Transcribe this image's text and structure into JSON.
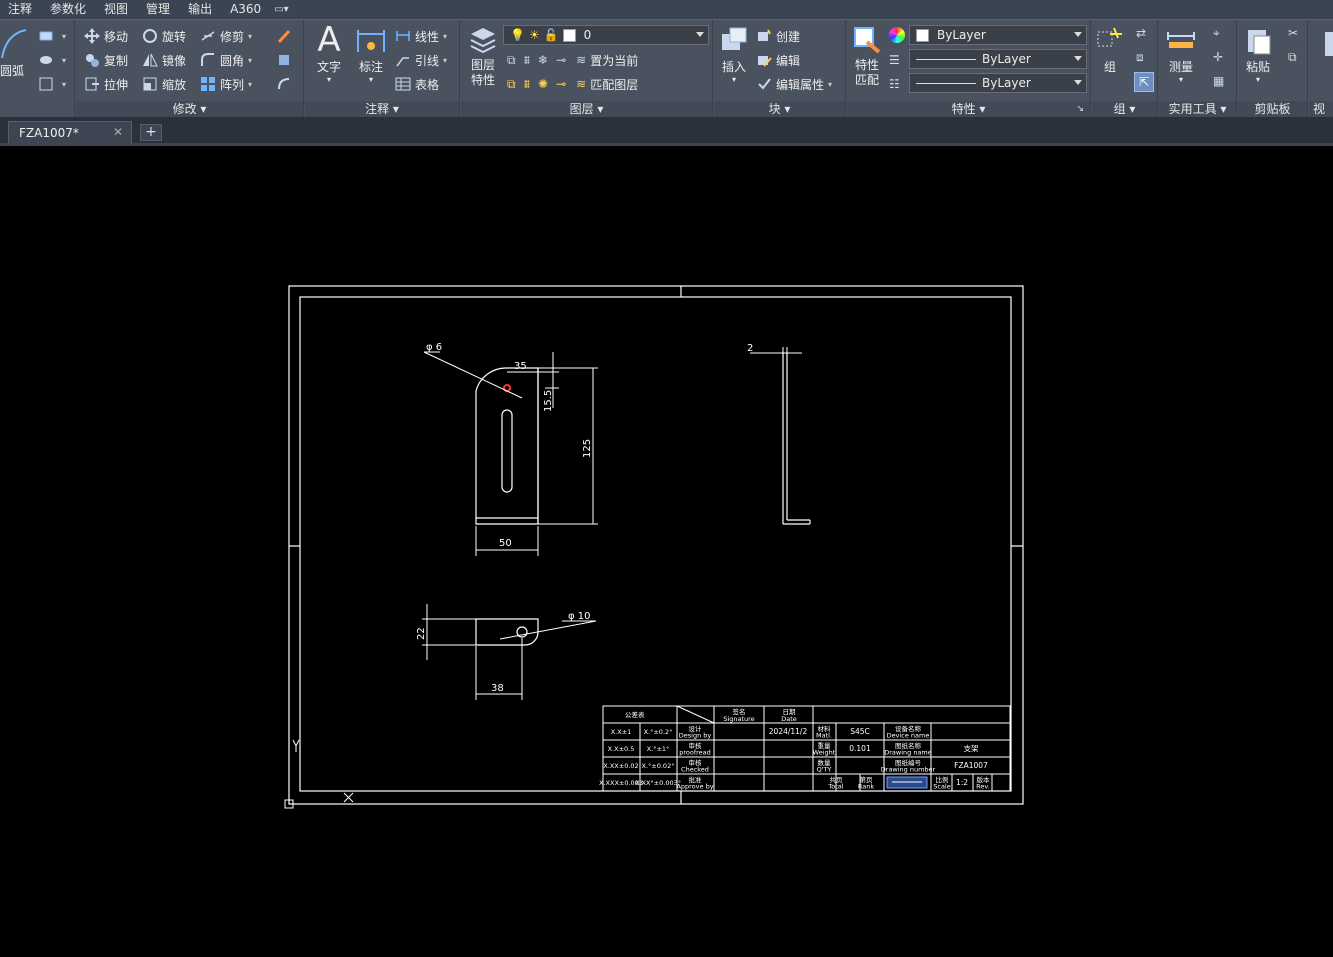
{
  "menu": {
    "items": [
      "注释",
      "参数化",
      "视图",
      "管理",
      "输出",
      "A360"
    ]
  },
  "ribbon": {
    "arc_label": "圆弧",
    "modify": {
      "title": "修改",
      "move": "移动",
      "rotate": "旋转",
      "trim": "修剪",
      "copy": "复制",
      "mirror": "镜像",
      "fillet": "圆角",
      "stretch": "拉伸",
      "scale": "缩放",
      "array": "阵列"
    },
    "annotation": {
      "title": "注释",
      "text": "文字",
      "dimension": "标注",
      "linear": "线性",
      "leader": "引线",
      "table": "表格"
    },
    "layers": {
      "title": "图层",
      "layer_props": "图层\n特性",
      "layer_name": "0",
      "set_current": "置为当前",
      "match_layer": "匹配图层"
    },
    "block": {
      "title": "块",
      "insert": "插入",
      "create": "创建",
      "edit": "编辑",
      "edit_attr": "编辑属性"
    },
    "properties": {
      "title": "特性",
      "match": "特性\n匹配",
      "color": "ByLayer",
      "linetype": "ByLayer",
      "lineweight": "ByLayer"
    },
    "group": {
      "title": "组",
      "group": "组"
    },
    "utilities": {
      "title": "实用工具",
      "measure": "测量"
    },
    "clipboard": {
      "title": "剪贴板",
      "paste": "粘贴"
    },
    "view": {
      "title": "视图"
    }
  },
  "tabs": {
    "document": "FZA1007*",
    "new_tab": "+"
  },
  "drawing": {
    "dims": {
      "phi6": "φ 6",
      "d35": "35",
      "d155": "15.5",
      "d125": "125",
      "d50": "50",
      "d2": "2",
      "d22": "22",
      "phi10": "φ 10",
      "d38": "38"
    },
    "title_block": {
      "tol_header": "公差表",
      "col_sig": "签名\nSignature",
      "col_date": "日期\nDate",
      "tol_rows": [
        [
          "X.X±1",
          "X.°±0.2°"
        ],
        [
          "X.X±0.5",
          "X.°±1°"
        ],
        [
          "X.XX±0.02",
          "X.°±0.02°"
        ],
        [
          "X.XXX±0.003",
          "X.XX°±0.003°"
        ]
      ],
      "roles": [
        "设计\nDesign by",
        "审核\nproofread",
        "审核\nChecked",
        "批准\nApprove by"
      ],
      "date": "2024/11/2",
      "matl_label": "材料\nMatl.",
      "matl_value": "S45C",
      "weight_label": "重量\nWeight",
      "weight_value": "0.101",
      "qty_label": "数量\nQ'TY",
      "total_label": "共页\nTotal",
      "rank_label": "第页\nRank",
      "device_label": "设备名称\nDevice name",
      "drawing_name_label": "图纸名称\nDrawing name",
      "drawing_name_value": "支架",
      "drawing_number_label": "图纸编号\nDrawing number",
      "drawing_number_value": "FZA1007",
      "scale_label": "比例\nScale",
      "scale_value": "1:2",
      "rev_label": "版本\nRev."
    }
  }
}
